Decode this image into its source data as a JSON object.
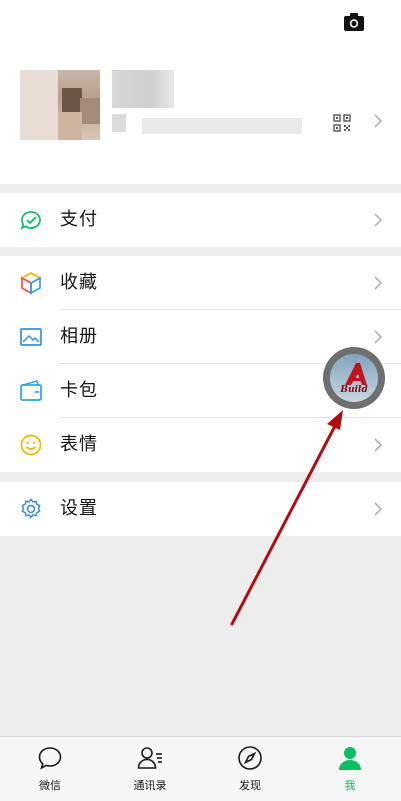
{
  "menu_groups": [
    {
      "items": [
        {
          "id": "pay",
          "label": "支付"
        }
      ]
    },
    {
      "items": [
        {
          "id": "favorites",
          "label": "收藏"
        },
        {
          "id": "album",
          "label": "相册"
        },
        {
          "id": "cards",
          "label": "卡包"
        },
        {
          "id": "stickers",
          "label": "表情"
        }
      ]
    },
    {
      "items": [
        {
          "id": "settings",
          "label": "设置"
        }
      ]
    }
  ],
  "tabbar": {
    "tabs": [
      {
        "label": "微信",
        "icon": "chat-bubble-icon"
      },
      {
        "label": "通讯录",
        "icon": "contacts-icon"
      },
      {
        "label": "发现",
        "icon": "compass-icon"
      },
      {
        "label": "我",
        "icon": "person-icon",
        "active": true
      }
    ]
  },
  "floating_badge": {
    "text": "Build"
  },
  "colors": {
    "accent": "#07c160",
    "arrow": "#b10d12",
    "background": "#ededed"
  }
}
